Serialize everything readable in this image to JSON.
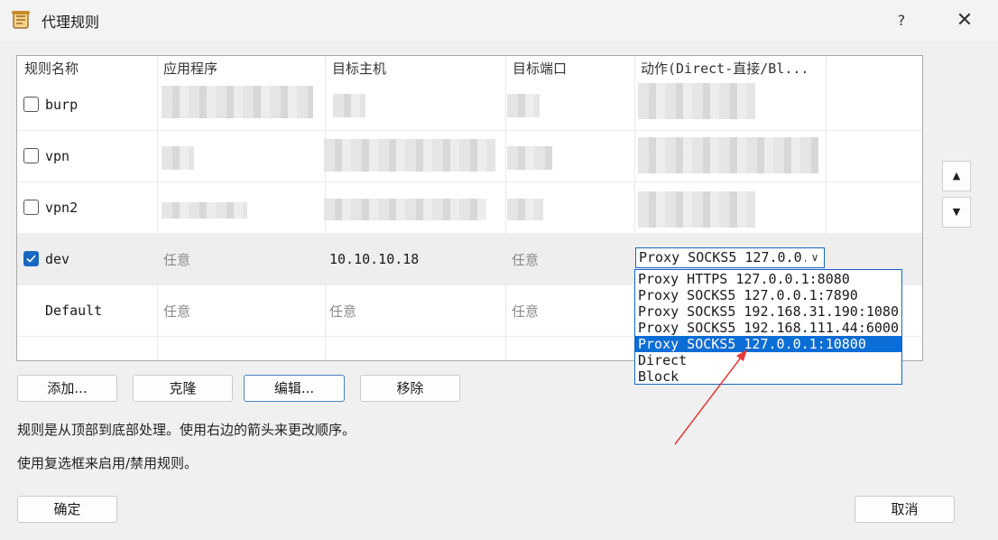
{
  "window": {
    "title": "代理规则",
    "help_label": "?",
    "close_label": "✕"
  },
  "table": {
    "columns": [
      "规则名称",
      "应用程序",
      "目标主机",
      "目标端口",
      "动作(Direct-直接/Bl..."
    ],
    "rows": [
      {
        "name": "burp",
        "checked": false
      },
      {
        "name": "vpn",
        "checked": false
      },
      {
        "name": "vpn2",
        "checked": false
      },
      {
        "name": "dev",
        "checked": true,
        "app": "任意",
        "host": "10.10.10.18",
        "port": "任意",
        "action": "Proxy SOCKS5 127.0.0.1:10800"
      },
      {
        "name": "Default",
        "app": "任意",
        "host": "任意",
        "port": "任意"
      }
    ]
  },
  "combo": {
    "value": "Proxy SOCKS5 127.0.0.1:10800",
    "arrow": "∨"
  },
  "dropdown": {
    "options": [
      "Proxy HTTPS 127.0.0.1:8080",
      "Proxy SOCKS5 127.0.0.1:7890",
      "Proxy SOCKS5 192.168.31.190:1080",
      "Proxy SOCKS5 192.168.111.44:6000",
      "Proxy SOCKS5 127.0.0.1:10800",
      "Direct",
      "Block"
    ],
    "selected_index": 4
  },
  "side": {
    "up": "▲",
    "down": "▼"
  },
  "buttons": {
    "add": "添加...",
    "clone": "克隆",
    "edit": "编辑...",
    "remove": "移除",
    "ok": "确定",
    "cancel": "取消"
  },
  "info": {
    "line1": "规则是从顶部到底部处理。使用右边的箭头来更改顺序。",
    "line2": "使用复选框来启用/禁用规则。"
  },
  "colors": {
    "accent": "#0b6dd6",
    "arrow": "#e53935"
  }
}
